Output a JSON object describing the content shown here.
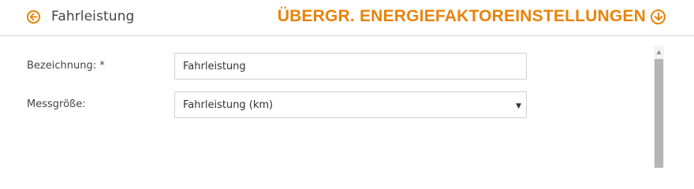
{
  "header": {
    "back_icon": "arrow-left-circle-icon",
    "back_title": "Fahrleistung",
    "section_title": "ÜBERGR. ENERGIEFAKTOREINSTELLUNGEN",
    "section_icon": "arrow-down-circle-icon",
    "accent_color": "#e8830a"
  },
  "form": {
    "name_label": "Bezeichnung: *",
    "name_value": "Fahrleistung",
    "measure_label": "Messgröße:",
    "measure_selected": "Fahrleistung (km)",
    "measure_arrow": "▼"
  },
  "scrollbar": {
    "up_arrow": "▲"
  }
}
